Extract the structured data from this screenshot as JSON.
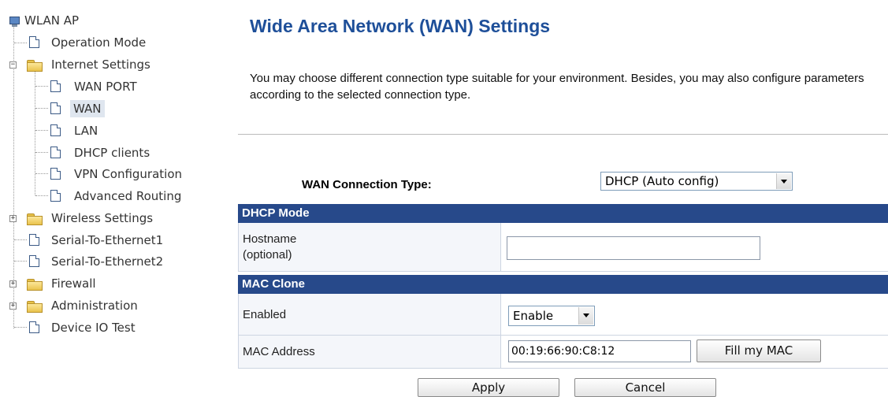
{
  "tree": {
    "root": "WLAN AP",
    "items": [
      {
        "label": "Operation Mode"
      },
      {
        "label": "Internet Settings"
      },
      {
        "label": "WAN PORT"
      },
      {
        "label": "WAN"
      },
      {
        "label": "LAN"
      },
      {
        "label": "DHCP clients"
      },
      {
        "label": "VPN Configuration"
      },
      {
        "label": "Advanced Routing"
      },
      {
        "label": "Wireless Settings"
      },
      {
        "label": "Serial-To-Ethernet1"
      },
      {
        "label": "Serial-To-Ethernet2"
      },
      {
        "label": "Firewall"
      },
      {
        "label": "Administration"
      },
      {
        "label": "Device IO Test"
      }
    ],
    "expand_minus": "−",
    "expand_plus": "+"
  },
  "page": {
    "title": "Wide Area Network (WAN) Settings",
    "intro": "You may choose different connection type suitable for your environment. Besides, you may also configure parameters according to the selected connection type."
  },
  "wan": {
    "connection_type_label": "WAN Connection Type:",
    "connection_type_value": "DHCP (Auto config)"
  },
  "dhcp": {
    "section_title": "DHCP Mode",
    "hostname_label_line1": "Hostname",
    "hostname_label_line2": "(optional)",
    "hostname_value": ""
  },
  "mac_clone": {
    "section_title": "MAC Clone",
    "enabled_label": "Enabled",
    "enabled_value": "Enable",
    "mac_label": "MAC Address",
    "mac_value": "00:19:66:90:C8:12",
    "fill_button": "Fill my MAC"
  },
  "actions": {
    "apply": "Apply",
    "cancel": "Cancel"
  },
  "colors": {
    "title": "#1e4f99",
    "section_bar": "#27498a"
  }
}
